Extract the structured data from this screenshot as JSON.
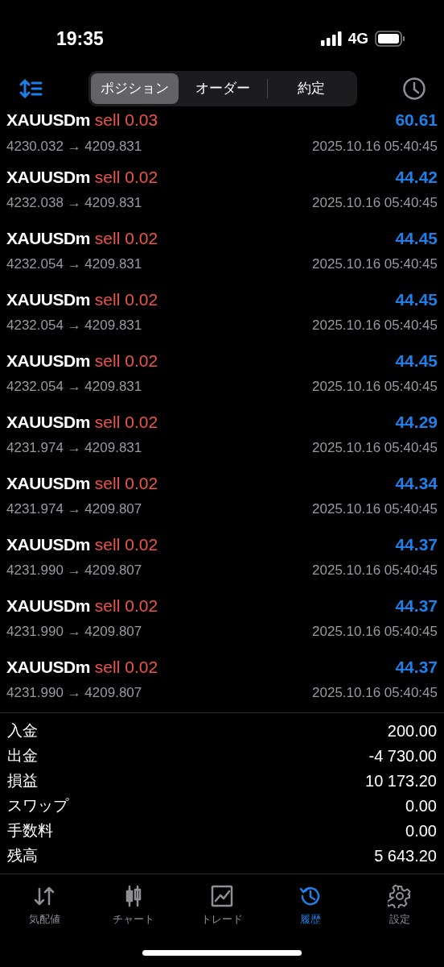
{
  "status_bar": {
    "time": "19:35",
    "network": "4G"
  },
  "segments": [
    {
      "label": "ポジション",
      "selected": true
    },
    {
      "label": "オーダー",
      "selected": false
    },
    {
      "label": "約定",
      "selected": false
    }
  ],
  "deals": [
    {
      "symbol": "XAUUSDm",
      "side": "sell",
      "volume": "0.03",
      "profit": "60.61",
      "prices": "4230.032 → 4209.831",
      "time": "2025.10.16 05:40:45"
    },
    {
      "symbol": "XAUUSDm",
      "side": "sell",
      "volume": "0.02",
      "profit": "44.42",
      "prices": "4232.038 → 4209.831",
      "time": "2025.10.16 05:40:45"
    },
    {
      "symbol": "XAUUSDm",
      "side": "sell",
      "volume": "0.02",
      "profit": "44.45",
      "prices": "4232.054 → 4209.831",
      "time": "2025.10.16 05:40:45"
    },
    {
      "symbol": "XAUUSDm",
      "side": "sell",
      "volume": "0.02",
      "profit": "44.45",
      "prices": "4232.054 → 4209.831",
      "time": "2025.10.16 05:40:45"
    },
    {
      "symbol": "XAUUSDm",
      "side": "sell",
      "volume": "0.02",
      "profit": "44.45",
      "prices": "4232.054 → 4209.831",
      "time": "2025.10.16 05:40:45"
    },
    {
      "symbol": "XAUUSDm",
      "side": "sell",
      "volume": "0.02",
      "profit": "44.29",
      "prices": "4231.974 → 4209.831",
      "time": "2025.10.16 05:40:45"
    },
    {
      "symbol": "XAUUSDm",
      "side": "sell",
      "volume": "0.02",
      "profit": "44.34",
      "prices": "4231.974 → 4209.807",
      "time": "2025.10.16 05:40:45"
    },
    {
      "symbol": "XAUUSDm",
      "side": "sell",
      "volume": "0.02",
      "profit": "44.37",
      "prices": "4231.990 → 4209.807",
      "time": "2025.10.16 05:40:45"
    },
    {
      "symbol": "XAUUSDm",
      "side": "sell",
      "volume": "0.02",
      "profit": "44.37",
      "prices": "4231.990 → 4209.807",
      "time": "2025.10.16 05:40:45"
    },
    {
      "symbol": "XAUUSDm",
      "side": "sell",
      "volume": "0.02",
      "profit": "44.37",
      "prices": "4231.990 → 4209.807",
      "time": "2025.10.16 05:40:45"
    }
  ],
  "summary": [
    {
      "label": "入金",
      "value": "200.00"
    },
    {
      "label": "出金",
      "value": "-4 730.00"
    },
    {
      "label": "損益",
      "value": "10 173.20"
    },
    {
      "label": "スワップ",
      "value": "0.00"
    },
    {
      "label": "手数料",
      "value": "0.00"
    },
    {
      "label": "残高",
      "value": "5 643.20"
    }
  ],
  "tab_bar": [
    {
      "kind": "quotes",
      "label": "気配値",
      "selected": false
    },
    {
      "kind": "chart",
      "label": "チャート",
      "selected": false
    },
    {
      "kind": "trade",
      "label": "トレード",
      "selected": false
    },
    {
      "kind": "history",
      "label": "履歴",
      "selected": true
    },
    {
      "kind": "settings",
      "label": "設定",
      "selected": false
    }
  ]
}
